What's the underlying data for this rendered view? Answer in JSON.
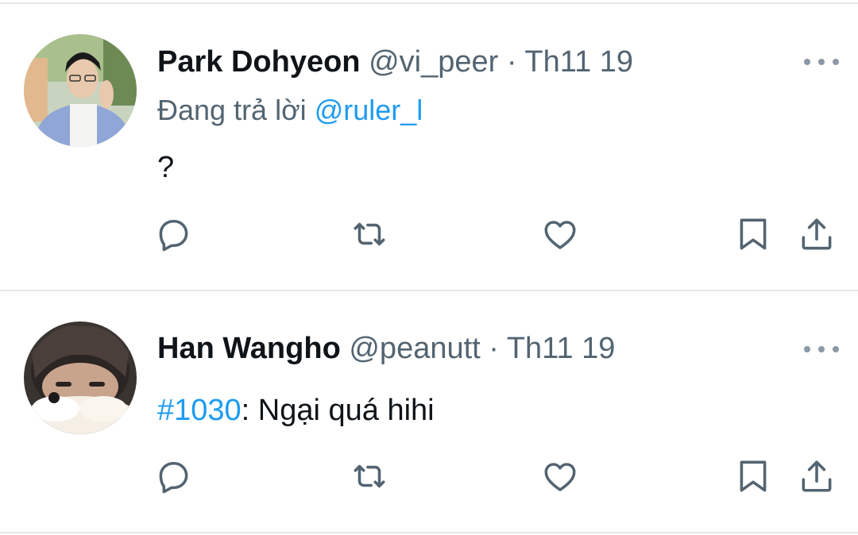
{
  "tweets": [
    {
      "author_name": "Park Dohyeon",
      "handle": "@vi_peer",
      "separator": "·",
      "time": "Th11 19",
      "replying_prefix": "Đang trả lời",
      "replying_to": "@ruler_l",
      "text": "?",
      "avatar": "avatar-photo-person-glasses"
    },
    {
      "author_name": "Han Wangho",
      "handle": "@peanutt",
      "separator": "·",
      "time": "Th11 19",
      "hashtag": "#1030",
      "text": ": Ngại quá hihi",
      "avatar": "avatar-photo-person-covered-face"
    }
  ],
  "icons": {
    "more": "more-horizontal-icon",
    "reply": "reply-icon",
    "retweet": "retweet-icon",
    "like": "like-icon",
    "bookmark": "bookmark-icon",
    "share": "share-icon"
  },
  "colors": {
    "text": "#0f1419",
    "secondary": "#536471",
    "link": "#1d9bf0",
    "divider": "#e6e8ea"
  }
}
